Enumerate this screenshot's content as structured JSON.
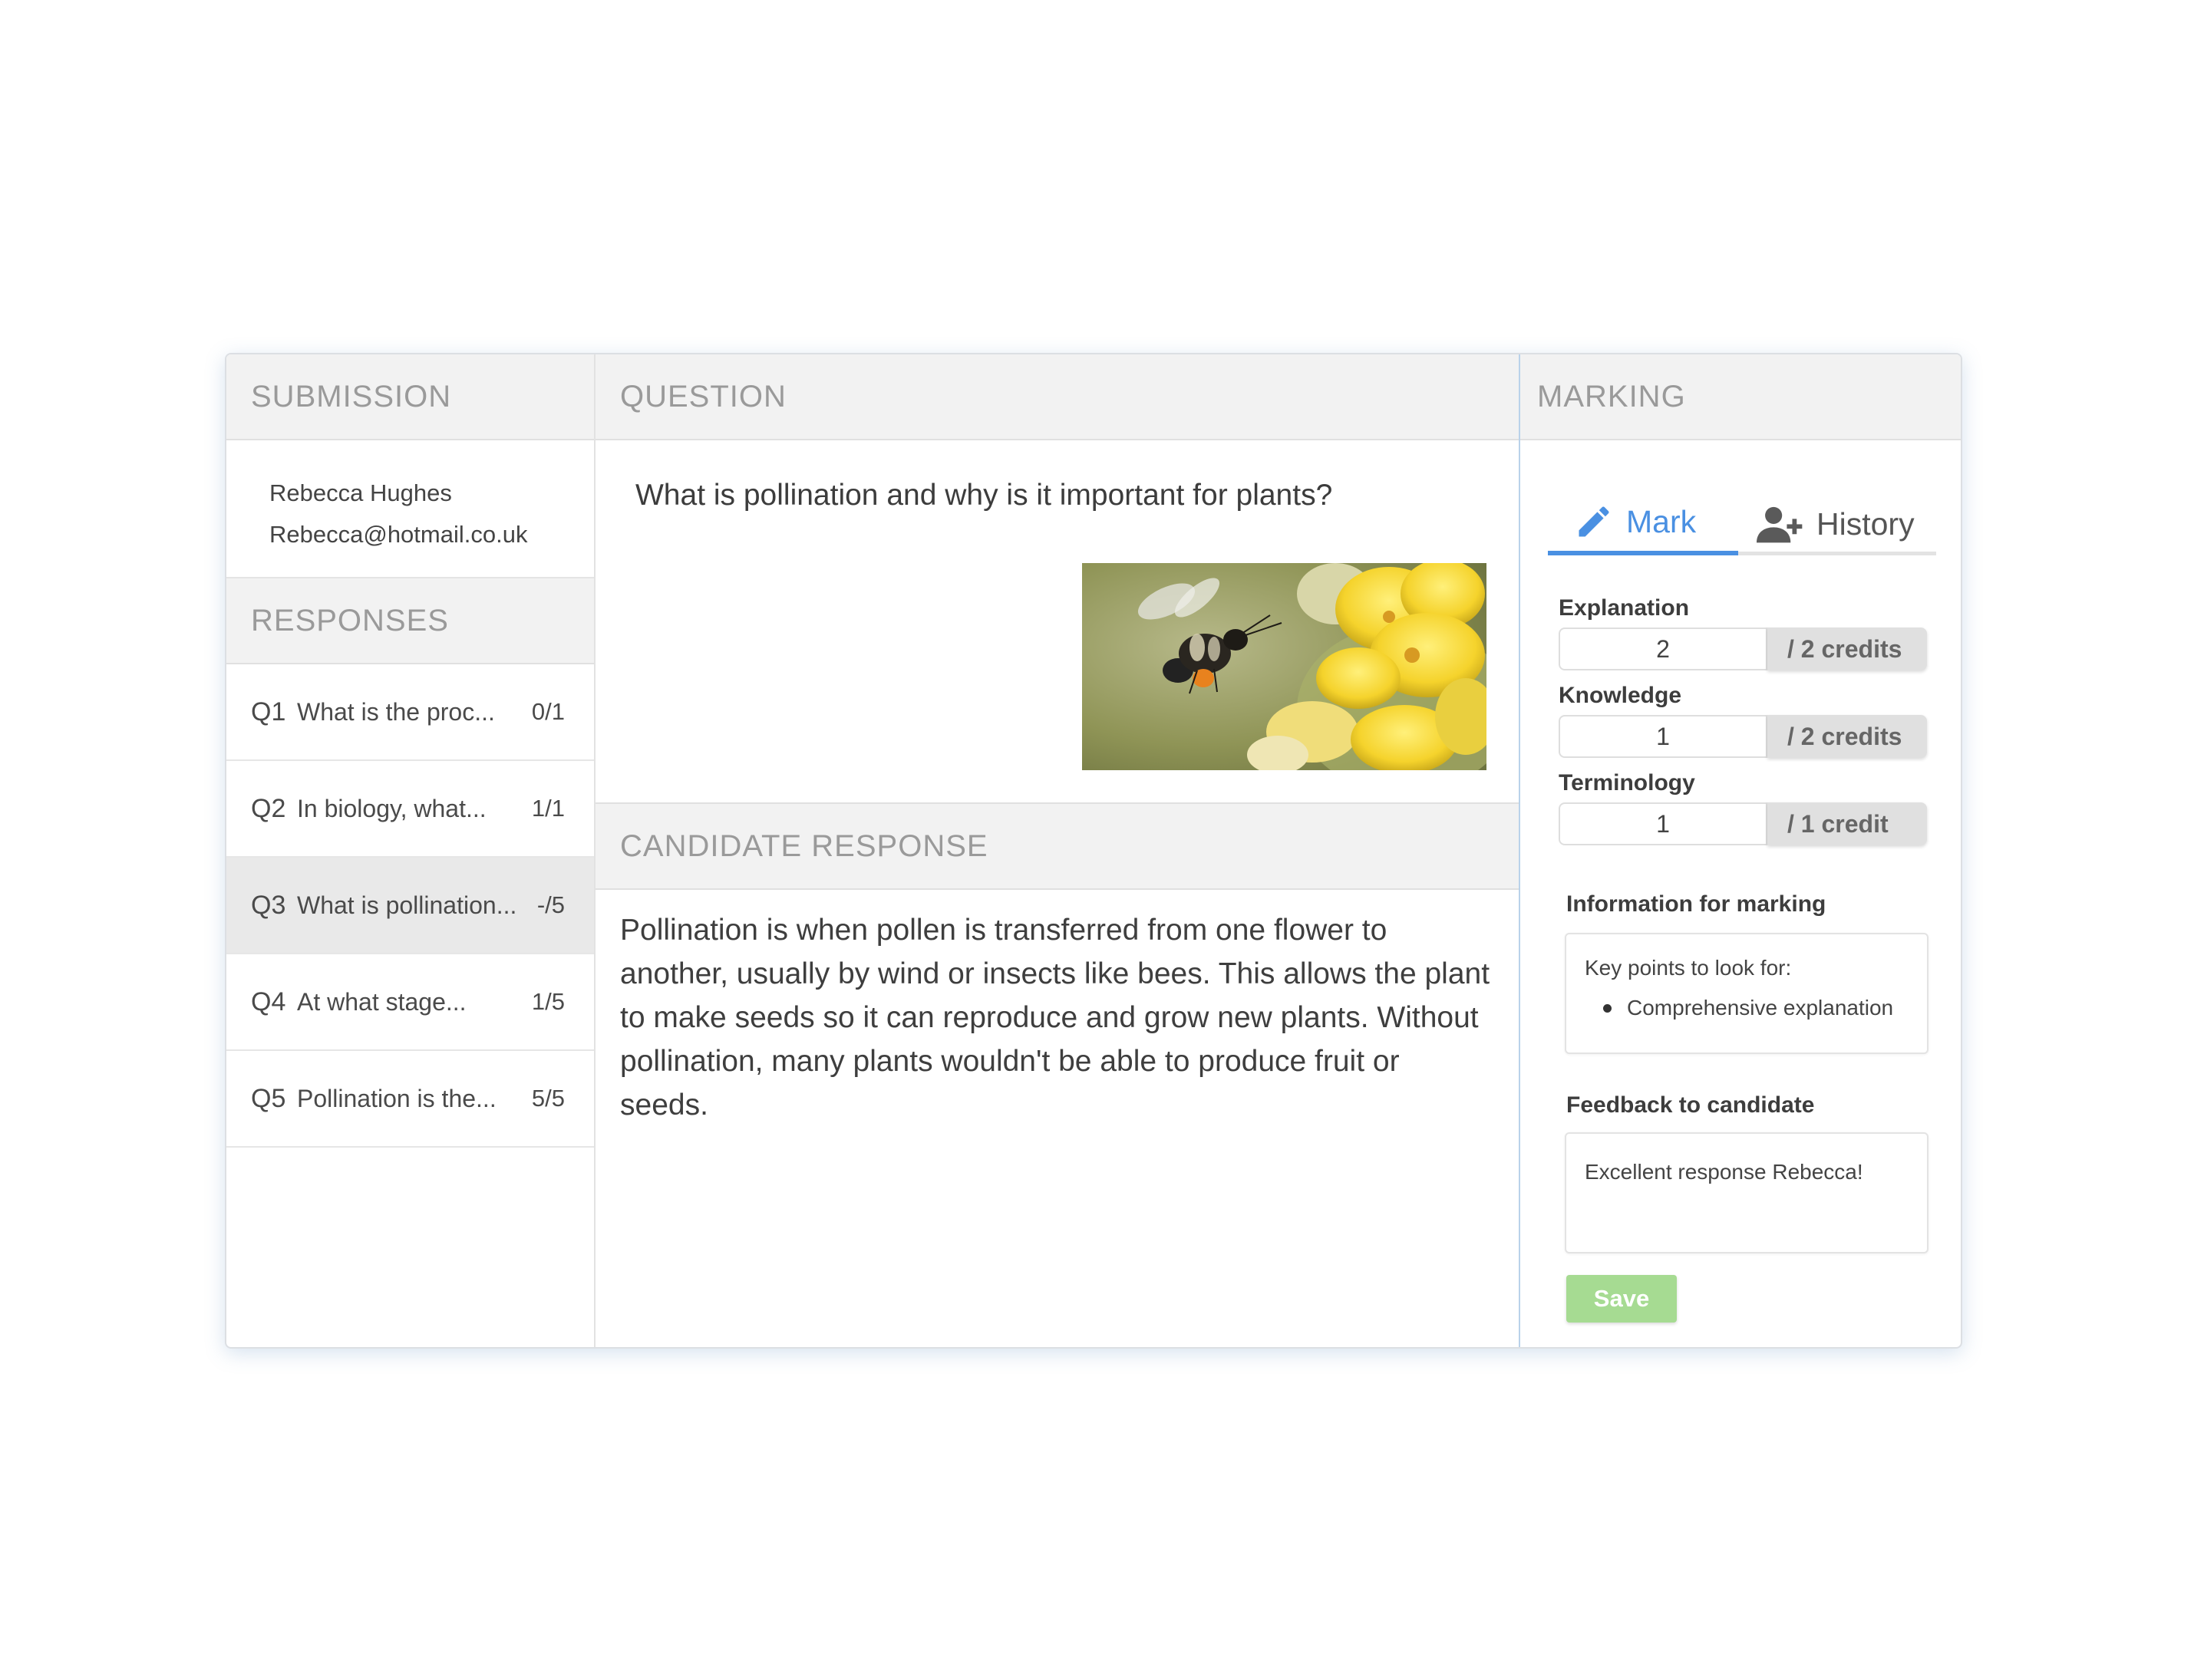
{
  "sections": {
    "submission": "SUBMISSION",
    "question": "QUESTION",
    "marking": "MARKING",
    "responses": "RESPONSES",
    "candidate_response": "CANDIDATE RESPONSE"
  },
  "submitter": {
    "name": "Rebecca Hughes",
    "email": "Rebecca@hotmail.co.uk"
  },
  "responses": [
    {
      "num": "Q1",
      "text": "What is the proc...",
      "score": "0/1"
    },
    {
      "num": "Q2",
      "text": "In biology, what...",
      "score": "1/1"
    },
    {
      "num": "Q3",
      "text": "What is pollination...",
      "score": "-/5"
    },
    {
      "num": "Q4",
      "text": "At what stage...",
      "score": "1/5"
    },
    {
      "num": "Q5",
      "text": "Pollination is the...",
      "score": "5/5"
    }
  ],
  "question": {
    "text": "What is pollination and why is it important for plants?",
    "image_icon": "bee-on-flower-image"
  },
  "candidate_response": "Pollination is when pollen is transferred from one flower to another, usually by wind or insects like bees. This allows the plant to make seeds so it can reproduce and grow new plants. Without pollination, many plants wouldn't be able to produce fruit or seeds.",
  "marking": {
    "tabs": {
      "mark": "Mark",
      "history": "History"
    },
    "criteria": [
      {
        "label": "Explanation",
        "value": "2",
        "max": "/ 2 credits"
      },
      {
        "label": "Knowledge",
        "value": "1",
        "max": "/ 2 credits"
      },
      {
        "label": "Terminology",
        "value": "1",
        "max": "/  1 credit"
      }
    ],
    "info_label": "Information for marking",
    "info_intro": "Key points to look for:",
    "info_points": [
      "Comprehensive explanation"
    ],
    "feedback_label": "Feedback to candidate",
    "feedback_value": "Excellent response Rebecca!",
    "save_label": "Save"
  },
  "colors": {
    "accent": "#4a90e2",
    "save": "#a6db92",
    "active_row": "#e9e9e9"
  }
}
